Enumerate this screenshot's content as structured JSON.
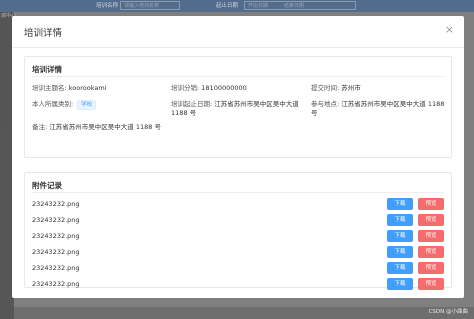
{
  "background": {
    "nav_label": "城中心",
    "filters": [
      {
        "label": "培训名称",
        "placeholder": "请输入培训名称"
      },
      {
        "label": "起止日期",
        "placeholder_start": "开始日期",
        "placeholder_end": "结束日期"
      }
    ]
  },
  "modal": {
    "title": "培训详情",
    "close_icon": "×"
  },
  "detail": {
    "section_title": "培训详情",
    "fields": {
      "topic": {
        "label": "培训主题名:",
        "value": "koorookami"
      },
      "phone": {
        "label": "培训分销:",
        "value": "18100000000"
      },
      "submit_time": {
        "label": "提交时间:",
        "value": "苏州市"
      },
      "category": {
        "label": "本人所属类别:",
        "value": "学校"
      },
      "date_range": {
        "label": "培训起止日期:",
        "value": "江苏省苏州市吴中区吴中大道1188 号"
      },
      "location": {
        "label": "参与地点:",
        "value": "江苏省苏州市吴中区吴中大道 1188 号"
      },
      "remark": {
        "label": "备注:",
        "value": "江苏省苏州市吴中区吴中大道 1188 号"
      }
    }
  },
  "files": {
    "section_title": "附件记录",
    "download_label": "下载",
    "preview_label": "预览",
    "items": [
      {
        "name": "23243232.png"
      },
      {
        "name": "23243232.png"
      },
      {
        "name": "23243232.png"
      },
      {
        "name": "23243232.png"
      },
      {
        "name": "23243232.png"
      },
      {
        "name": "23243232.png"
      }
    ]
  },
  "watermark": "CSDN @小曲曲",
  "colors": {
    "primary": "#409eff",
    "danger": "#f56c6c",
    "overlay": "#7f7f7f"
  }
}
